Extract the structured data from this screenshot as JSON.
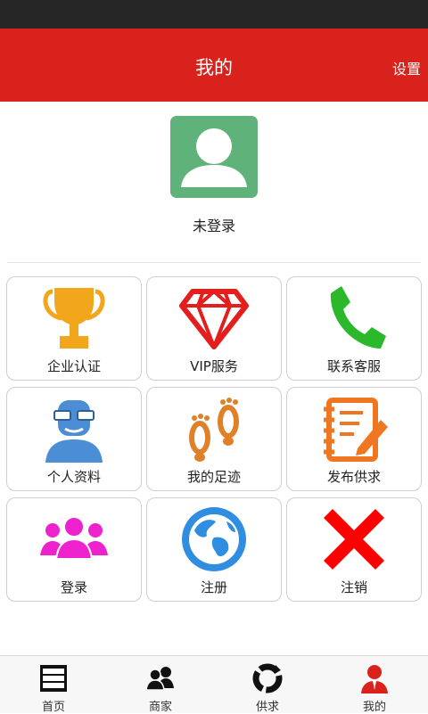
{
  "header": {
    "title": "我的",
    "settings_label": "设置"
  },
  "profile": {
    "username": "未登录",
    "avatar_icon": "user-silhouette-icon"
  },
  "grid": [
    {
      "label": "企业认证",
      "icon": "trophy-icon"
    },
    {
      "label": "VIP服务",
      "icon": "diamond-icon"
    },
    {
      "label": "联系客服",
      "icon": "phone-icon"
    },
    {
      "label": "个人资料",
      "icon": "person-glasses-icon"
    },
    {
      "label": "我的足迹",
      "icon": "footprints-icon"
    },
    {
      "label": "发布供求",
      "icon": "edit-notebook-icon"
    },
    {
      "label": "登录",
      "icon": "people-group-icon"
    },
    {
      "label": "注册",
      "icon": "globe-icon"
    },
    {
      "label": "注销",
      "icon": "cross-icon"
    }
  ],
  "tabbar": [
    {
      "label": "首页",
      "icon": "home-icon",
      "active": false
    },
    {
      "label": "商家",
      "icon": "merchants-icon",
      "active": false
    },
    {
      "label": "供求",
      "icon": "supply-demand-icon",
      "active": false
    },
    {
      "label": "我的",
      "icon": "profile-icon",
      "active": true
    }
  ],
  "colors": {
    "header": "#d9221c",
    "avatar_bg": "#5fb27a",
    "active_tab": "#d9221c"
  }
}
